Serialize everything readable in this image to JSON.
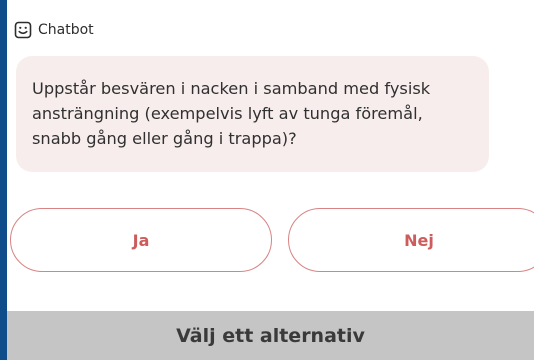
{
  "header": {
    "icon": "chatbot-smile-icon",
    "label": "Chatbot"
  },
  "message": {
    "text": "Uppstår besvären i nacken i samband med fysisk ansträngning (exempelvis lyft av tunga föremål, snabb gång eller gång i trappa)?"
  },
  "choices": [
    {
      "label": "Ja"
    },
    {
      "label": "Nej"
    }
  ],
  "footer": {
    "label": "Välj ett alternativ"
  },
  "colors": {
    "accent_border": "#0f4c8a",
    "bubble_bg": "#f8eded",
    "button_border": "#d88484",
    "button_text": "#cd5c5c",
    "footer_bg": "#c5c5c5"
  }
}
